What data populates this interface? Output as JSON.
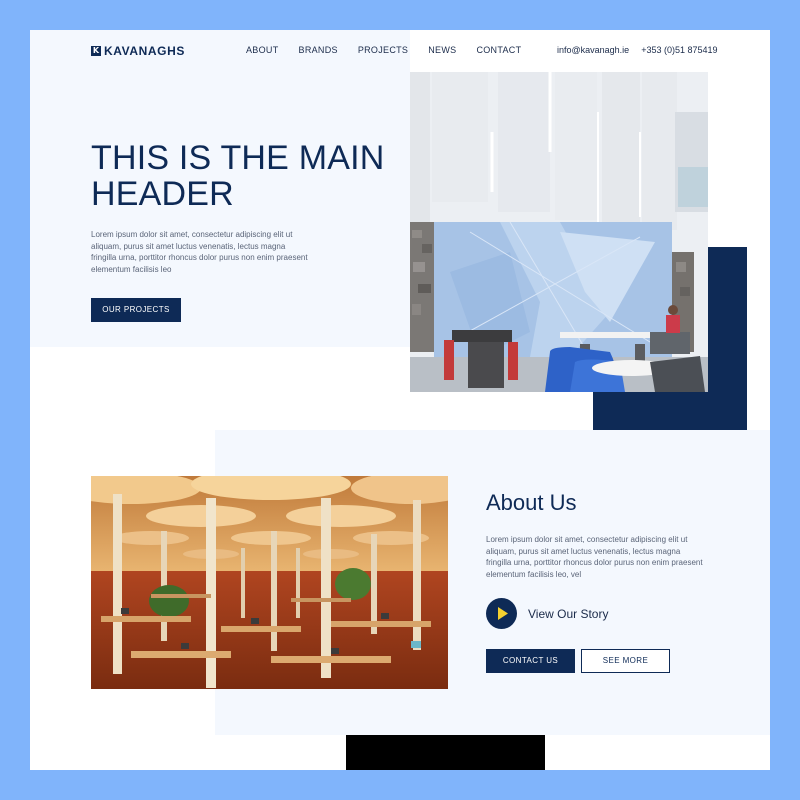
{
  "brand": {
    "logo_mark": "K",
    "name": "KAVANAGHS"
  },
  "nav": {
    "items": [
      "ABOUT",
      "BRANDS",
      "PROJECTS",
      "NEWS",
      "CONTACT"
    ]
  },
  "contact": {
    "email": "info@kavanagh.ie",
    "phone": "+353 (0)51 875419"
  },
  "hero": {
    "title": "THIS IS THE MAIN HEADER",
    "text": "Lorem ipsum dolor sit amet, consectetur adipiscing elit ut aliquam, purus sit amet luctus venenatis, lectus magna fringilla urna, porttitor rhoncus dolor purus non enim praesent elementum facilisis leo",
    "button": "OUR PROJECTS"
  },
  "about": {
    "title": "About Us",
    "text": "Lorem ipsum dolor sit amet, consectetur adipiscing elit ut aliquam, purus sit amet luctus venenatis, lectus magna fringilla urna, porttitor rhoncus dolor purus non enim praesent elementum facilisis leo, vel",
    "story_label": "View Our Story",
    "contact_button": "CONTACT US",
    "see_more_button": "SEE MORE"
  },
  "colors": {
    "primary": "#0e2a56",
    "frame": "#80b4fb",
    "section_bg": "#f4f8fe",
    "accent": "#f5d130"
  },
  "icons": {
    "play": "play-icon"
  }
}
